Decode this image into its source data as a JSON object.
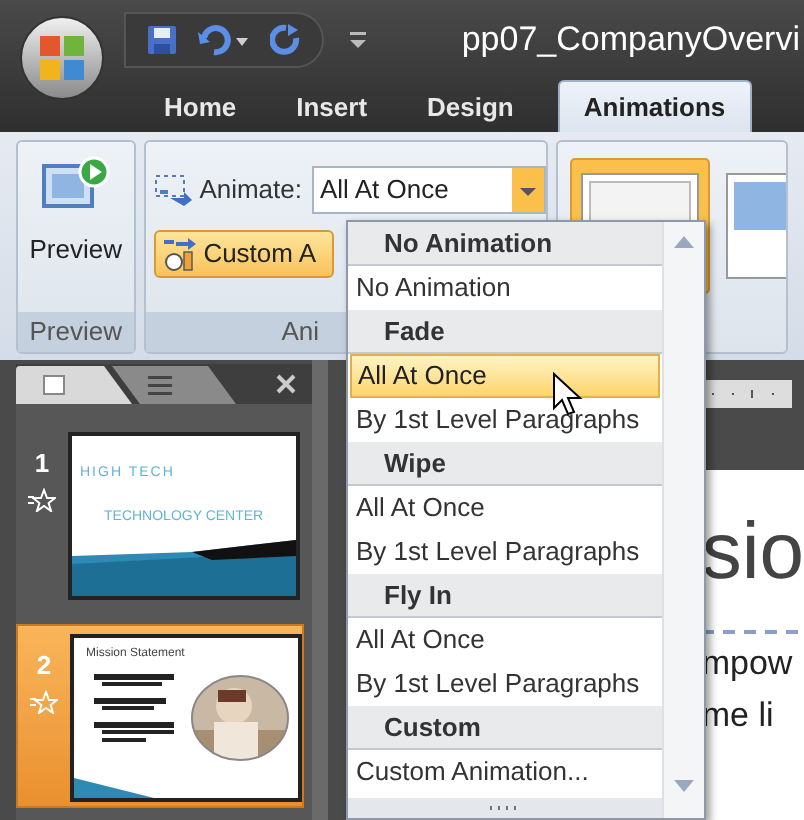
{
  "title_bar": {
    "title": "pp07_CompanyOvervi"
  },
  "tabs": [
    {
      "label": "Home",
      "selected": false
    },
    {
      "label": "Insert",
      "selected": false
    },
    {
      "label": "Design",
      "selected": false
    },
    {
      "label": "Animations",
      "selected": true
    }
  ],
  "ribbon": {
    "preview_group": {
      "button": "Preview",
      "label": "Preview"
    },
    "animations_group": {
      "animate_label": "Animate:",
      "animate_value": "All At Once",
      "custom_button": "Custom A",
      "label": "Ani"
    }
  },
  "dropdown": {
    "items": [
      {
        "kind": "header",
        "label": "No Animation"
      },
      {
        "kind": "option",
        "label": "No Animation",
        "selected": false
      },
      {
        "kind": "header",
        "label": "Fade"
      },
      {
        "kind": "option",
        "label": "All At Once",
        "selected": true
      },
      {
        "kind": "option",
        "label": "By 1st Level Paragraphs",
        "selected": false
      },
      {
        "kind": "header",
        "label": "Wipe"
      },
      {
        "kind": "option",
        "label": "All At Once",
        "selected": false
      },
      {
        "kind": "option",
        "label": "By 1st Level Paragraphs",
        "selected": false
      },
      {
        "kind": "header",
        "label": "Fly In"
      },
      {
        "kind": "option",
        "label": "All At Once",
        "selected": false
      },
      {
        "kind": "option",
        "label": "By 1st Level Paragraphs",
        "selected": false
      },
      {
        "kind": "header",
        "label": "Custom"
      },
      {
        "kind": "option",
        "label": "Custom Animation...",
        "selected": false
      }
    ]
  },
  "slides": [
    {
      "number": "1",
      "selected": false,
      "kind": "title",
      "title": "HIGH TECH",
      "subtitle": "TECHNOLOGY CENTER"
    },
    {
      "number": "2",
      "selected": true,
      "kind": "content",
      "title": "Mission Statement"
    }
  ],
  "slide_editor": {
    "texts": [
      "sio",
      "mpow",
      "me li"
    ]
  }
}
